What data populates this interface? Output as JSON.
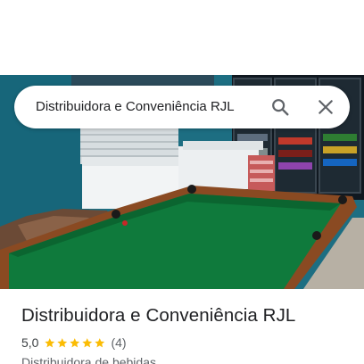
{
  "search": {
    "query": "Distribuidora e Conveniência RJL",
    "search_icon": "search-icon",
    "close_icon": "close-icon"
  },
  "photo": {
    "subject": "pool-table-store-photo"
  },
  "place": {
    "title": "Distribuidora e Conveniência RJL",
    "rating": "5,0",
    "stars": 5,
    "review_count": "(4)",
    "category": "Distribuidora de bebidas"
  },
  "colors": {
    "star": "#fbbc04",
    "text_primary": "#202124",
    "text_secondary": "#5f6368",
    "icon": "#5f6368"
  }
}
